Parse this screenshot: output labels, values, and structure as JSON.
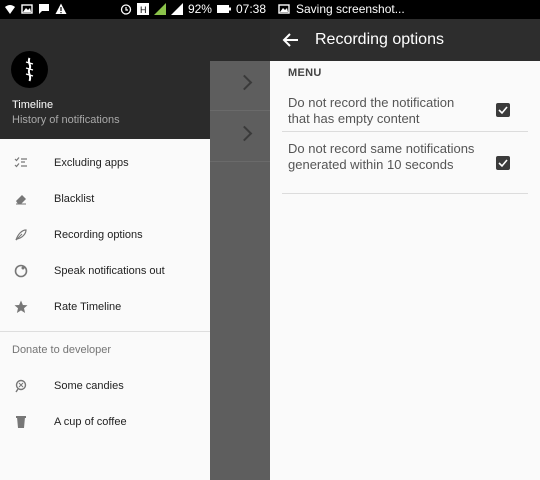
{
  "status_bar_left": {
    "battery_percent": "92%",
    "time": "07:38"
  },
  "status_bar_right": {
    "notice": "Saving screenshot..."
  },
  "drawer": {
    "app_title": "Timeline",
    "app_subtitle": "History of notifications",
    "menu_items": [
      {
        "label": "Excluding apps",
        "icon": "checklist-icon"
      },
      {
        "label": "Blacklist",
        "icon": "eraser-icon"
      },
      {
        "label": "Recording options",
        "icon": "feather-icon"
      },
      {
        "label": "Speak notifications out",
        "icon": "speech-icon"
      },
      {
        "label": "Rate Timeline",
        "icon": "star-icon"
      }
    ],
    "donate_label": "Donate to developer",
    "donate_items": [
      {
        "label": "Some candies",
        "icon": "candy-icon"
      },
      {
        "label": "A cup of coffee",
        "icon": "coffee-icon"
      }
    ]
  },
  "recording_options": {
    "title": "Recording options",
    "section": "MENU",
    "options": [
      {
        "label": "Do not record the notification that has empty content",
        "checked": true
      },
      {
        "label": "Do not record same notifications generated within 10 seconds",
        "checked": true
      }
    ]
  },
  "colors": {
    "toolbar": "#2d2d2d",
    "drawer_header": "#2b2b2b",
    "checkbox": "#3b3b3b",
    "battery_accent": "#8bc34a"
  }
}
